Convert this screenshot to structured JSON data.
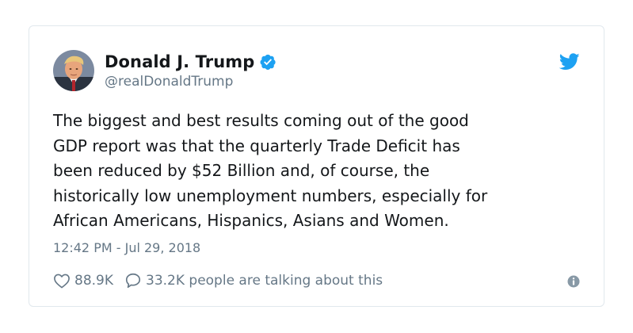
{
  "tweet": {
    "author": {
      "display_name": "Donald J. Trump",
      "handle": "@realDonaldTrump",
      "verified": true,
      "avatar": "profile-photo"
    },
    "text": "The biggest and best results coming out of the good\nGDP report was that the quarterly Trade Deficit has\nbeen reduced by $52 Billion and, of course, the\nhistorically low unemployment numbers, especially for\nAfrican Americans, Hispanics, Asians and Women.",
    "timestamp": "12:42 PM - Jul 29, 2018",
    "likes": "88.9K",
    "replies_text": "33.2K people are talking about this",
    "icons": {
      "brand": "twitter-bird-icon",
      "like": "heart-icon",
      "reply": "speech-bubble-icon",
      "info": "info-icon",
      "verified": "verified-badge-icon"
    },
    "colors": {
      "brand_blue": "#1da1f2",
      "text": "#14171a",
      "muted": "#657786",
      "border": "#e1e8ed"
    }
  }
}
